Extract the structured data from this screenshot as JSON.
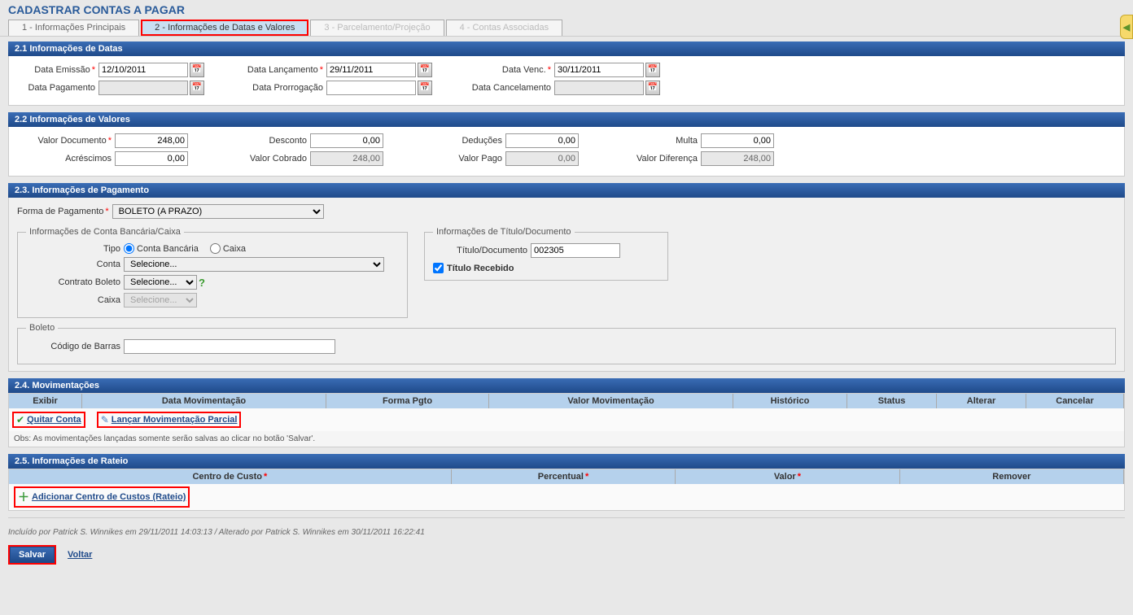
{
  "page_title": "CADASTRAR CONTAS A PAGAR",
  "tabs": [
    {
      "label": "1 - Informações Principais"
    },
    {
      "label": "2 - Informações de Datas e Valores"
    },
    {
      "label": "3 - Parcelamento/Projeção"
    },
    {
      "label": "4 - Contas Associadas"
    }
  ],
  "sec21": {
    "title": "2.1 Informações de Datas",
    "data_emissao_label": "Data Emissão",
    "data_emissao": "12/10/2011",
    "data_lancamento_label": "Data Lançamento",
    "data_lancamento": "29/11/2011",
    "data_venc_label": "Data Venc.",
    "data_venc": "30/11/2011",
    "data_pagamento_label": "Data Pagamento",
    "data_pagamento": "",
    "data_prorrogacao_label": "Data Prorrogação",
    "data_prorrogacao": "",
    "data_cancelamento_label": "Data Cancelamento",
    "data_cancelamento": ""
  },
  "sec22": {
    "title": "2.2 Informações de Valores",
    "valor_documento_label": "Valor Documento",
    "valor_documento": "248,00",
    "desconto_label": "Desconto",
    "desconto": "0,00",
    "deducoes_label": "Deduções",
    "deducoes": "0,00",
    "multa_label": "Multa",
    "multa": "0,00",
    "acrescimos_label": "Acréscimos",
    "acrescimos": "0,00",
    "valor_cobrado_label": "Valor Cobrado",
    "valor_cobrado": "248,00",
    "valor_pago_label": "Valor Pago",
    "valor_pago": "0,00",
    "valor_diferenca_label": "Valor Diferença",
    "valor_diferenca": "248,00"
  },
  "sec23": {
    "title": "2.3. Informações de Pagamento",
    "forma_pagamento_label": "Forma de Pagamento",
    "forma_pagamento": "BOLETO (A PRAZO)",
    "fieldset1_legend": "Informações de Conta Bancária/Caixa",
    "tipo_label": "Tipo",
    "tipo_opt1": "Conta Bancária",
    "tipo_opt2": "Caixa",
    "conta_label": "Conta",
    "conta_value": "Selecione...",
    "contrato_boleto_label": "Contrato Boleto",
    "contrato_boleto_value": "Selecione...",
    "caixa_label": "Caixa",
    "caixa_value": "Selecione...",
    "fieldset2_legend": "Informações de Título/Documento",
    "titulo_documento_label": "Título/Documento",
    "titulo_documento": "002305",
    "titulo_recebido_label": "Título Recebido",
    "fieldset3_legend": "Boleto",
    "codigo_barras_label": "Código de Barras",
    "codigo_barras": ""
  },
  "sec24": {
    "title": "2.4. Movimentações",
    "cols": [
      "Exibir",
      "Data Movimentação",
      "Forma Pgto",
      "Valor Movimentação",
      "Histórico",
      "Status",
      "Alterar",
      "Cancelar"
    ],
    "link_quitar": "Quitar Conta",
    "link_parcial": "Lançar Movimentação Parcial",
    "obs": "Obs: As movimentações lançadas somente serão salvas ao clicar no botão 'Salvar'."
  },
  "sec25": {
    "title": "2.5. Informações de Rateio",
    "cols": [
      "Centro de Custo",
      "Percentual",
      "Valor",
      "Remover"
    ],
    "link_add": "Adicionar Centro de Custos (Rateio)"
  },
  "footer": {
    "info": "Incluído por Patrick S. Winnikes em 29/11/2011 14:03:13 / Alterado por Patrick S. Winnikes em 30/11/2011 16:22:41",
    "salvar": "Salvar",
    "voltar": "Voltar"
  }
}
